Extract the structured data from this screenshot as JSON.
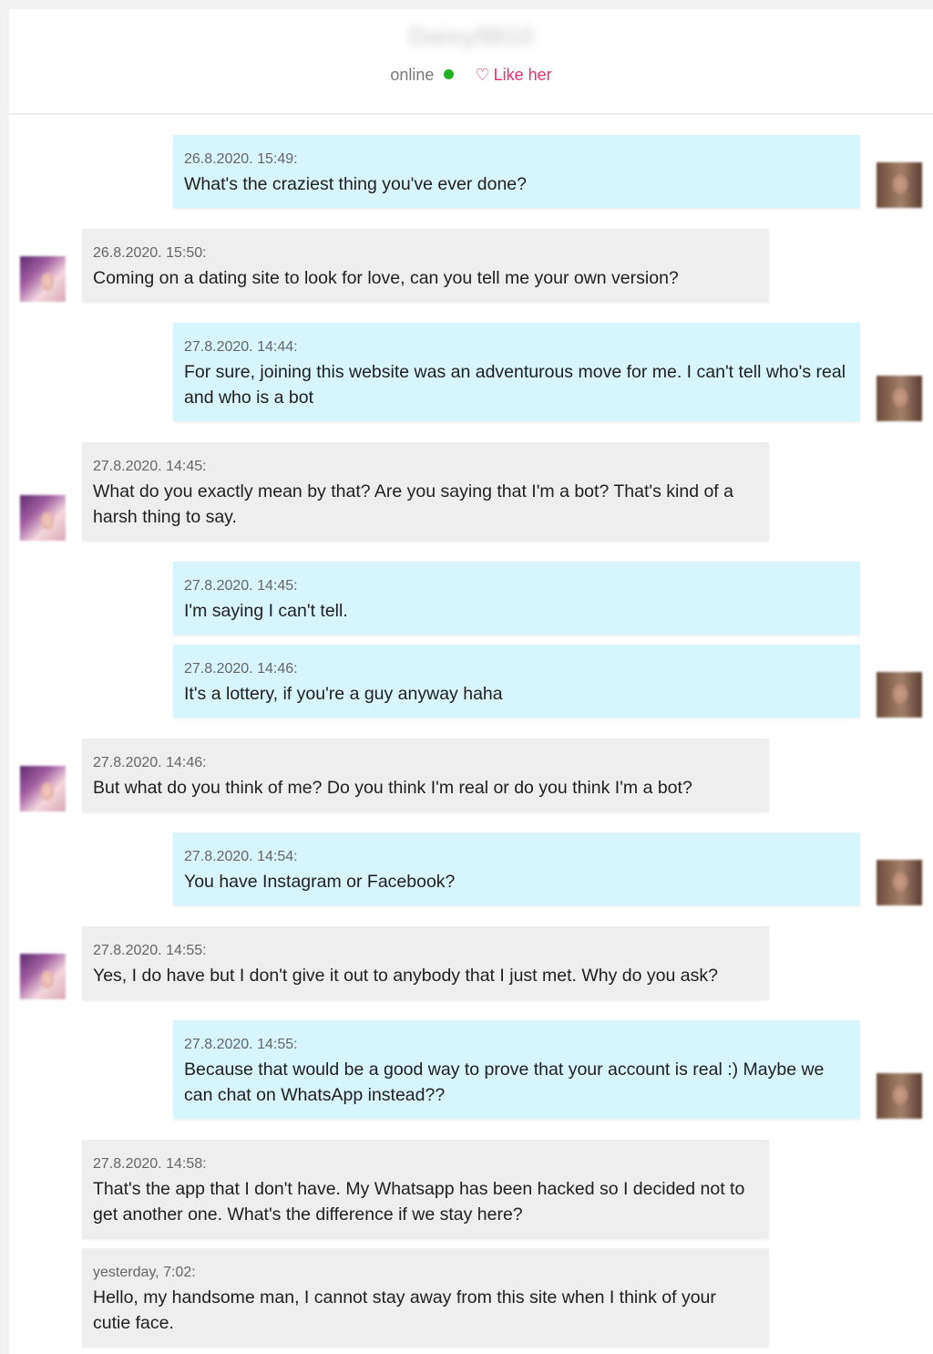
{
  "header": {
    "username": "Daisy9810",
    "status": "online",
    "status_color": "#22b322",
    "like_label": "Like her",
    "like_icon": "heart-outline-icon",
    "like_color": "#e8306d"
  },
  "colors": {
    "my_bubble": "#d6f5fc",
    "her_bubble": "#eeeeee"
  },
  "messages": [
    {
      "sender": "me",
      "timestamp": "26.8.2020. 15:49:",
      "text": "What's the craziest thing you've ever done?"
    },
    {
      "sender": "her",
      "timestamp": "26.8.2020. 15:50:",
      "text": "Coming on a dating site to look for love, can you tell me your own version?"
    },
    {
      "sender": "me",
      "timestamp": "27.8.2020. 14:44:",
      "text": "For sure, joining this website was an adventurous move for me. I can't tell who's real and who is a bot"
    },
    {
      "sender": "her",
      "timestamp": "27.8.2020. 14:45:",
      "text": "What do you exactly mean by that? Are you saying that I'm a bot? That's kind of a harsh thing to say."
    },
    {
      "sender": "me",
      "timestamp": "27.8.2020. 14:45:",
      "text": "I'm saying I can't tell."
    },
    {
      "sender": "me",
      "timestamp": "27.8.2020. 14:46:",
      "text": "It's a lottery, if you're a guy anyway haha"
    },
    {
      "sender": "her",
      "timestamp": "27.8.2020. 14:46:",
      "text": "But what do you think of me? Do you think I'm real or do you think I'm a bot?"
    },
    {
      "sender": "me",
      "timestamp": "27.8.2020. 14:54:",
      "text": "You have Instagram or Facebook?"
    },
    {
      "sender": "her",
      "timestamp": "27.8.2020. 14:55:",
      "text": "Yes, I do have but I don't give it out to anybody that I just met. Why do you ask?"
    },
    {
      "sender": "me",
      "timestamp": "27.8.2020. 14:55:",
      "text": "Because that would be a good way to prove that your account is real :) Maybe we can chat on WhatsApp instead??"
    },
    {
      "sender": "her",
      "timestamp": "27.8.2020. 14:58:",
      "text": "That's the app that I don't have. My Whatsapp has been hacked so I decided not to get another one. What's the difference if we stay here?"
    },
    {
      "sender": "her",
      "timestamp": "yesterday, 7:02:",
      "text": "Hello, my handsome man, I cannot stay away from this site when I think of your cutie face."
    }
  ]
}
